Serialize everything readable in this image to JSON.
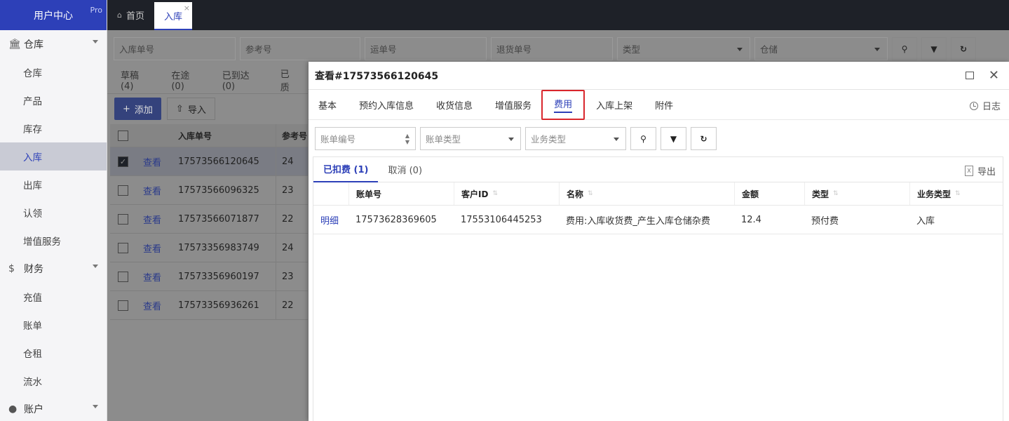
{
  "sidebar": {
    "brand": "用户中心",
    "brand_badge": "Pro",
    "groups": [
      {
        "label": "仓库",
        "icon": "bank-icon",
        "items": [
          "仓库",
          "产品",
          "库存",
          "入库",
          "出库",
          "认领",
          "增值服务"
        ]
      },
      {
        "label": "财务",
        "icon": "dollar-icon",
        "items": [
          "充值",
          "账单",
          "仓租",
          "流水"
        ]
      },
      {
        "label": "账户",
        "icon": "user-icon",
        "items": []
      }
    ],
    "active_item": "入库"
  },
  "top_tabs": [
    {
      "label": "首页",
      "icon": "home-icon"
    },
    {
      "label": "入库",
      "closable": true
    }
  ],
  "filters": {
    "inbound_no": "入库单号",
    "ref_no": "参考号",
    "tracking_no": "运单号",
    "return_no": "退货单号",
    "type": "类型",
    "warehouse": "仓储"
  },
  "status_tabs": [
    "草稿(4)",
    "在途(0)",
    "已到达(0)",
    "已质"
  ],
  "actions": {
    "add": "添加",
    "import": "导入"
  },
  "bg_table": {
    "headers": {
      "inbound_no": "入库单号",
      "ref": "参考号"
    },
    "view_label": "查看",
    "rows": [
      {
        "no": "17573566120645",
        "ref": "24",
        "selected": true
      },
      {
        "no": "17573566096325",
        "ref": "23",
        "selected": false
      },
      {
        "no": "17573566071877",
        "ref": "22",
        "selected": false
      },
      {
        "no": "17573356983749",
        "ref": "24",
        "selected": false
      },
      {
        "no": "17573356960197",
        "ref": "23",
        "selected": false
      },
      {
        "no": "17573356936261",
        "ref": "22",
        "selected": false
      }
    ]
  },
  "modal": {
    "title": "查看#17573566120645",
    "tabs": [
      "基本",
      "预约入库信息",
      "收货信息",
      "增值服务",
      "费用",
      "入库上架",
      "附件"
    ],
    "active_tab": "费用",
    "log_label": "日志",
    "filters": {
      "bill_no": "账单编号",
      "bill_type": "账单类型",
      "biz_type": "业务类型"
    },
    "sub_tabs": [
      "已扣费 (1)",
      "取消 (0)"
    ],
    "export_label": "导出",
    "columns": [
      "账单号",
      "客户ID",
      "名称",
      "金额",
      "类型",
      "业务类型"
    ],
    "detail_label": "明细",
    "rows": [
      {
        "bill_no": "17573628369605",
        "customer_id": "17553106445253",
        "name": "费用:入库收货费_产生入库仓储杂费",
        "amount": "12.4",
        "type": "预付费",
        "biz_type": "入库"
      }
    ]
  },
  "colors": {
    "brand": "#2d40b8",
    "topbar": "#1e2128",
    "highlight": "#d9262c"
  }
}
